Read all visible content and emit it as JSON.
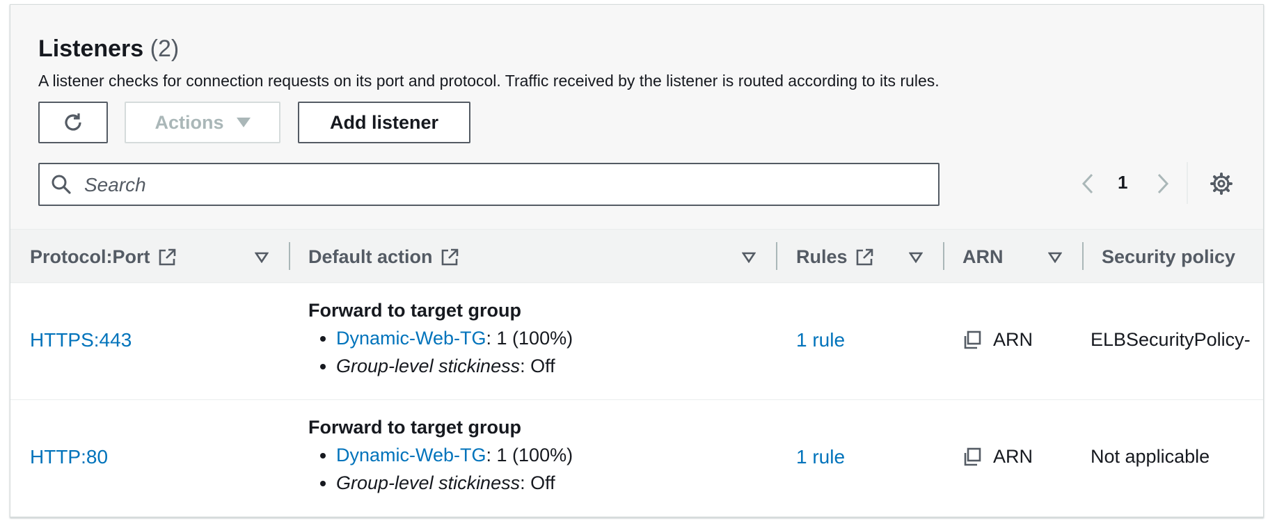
{
  "section": {
    "title": "Listeners",
    "count": "(2)",
    "description": "A listener checks for connection requests on its port and protocol. Traffic received by the listener is routed according to its rules."
  },
  "toolbar": {
    "actions_label": "Actions",
    "add_listener_label": "Add listener"
  },
  "search": {
    "placeholder": "Search"
  },
  "pagination": {
    "current_page": "1"
  },
  "columns": {
    "protocol_port": "Protocol:Port",
    "default_action": "Default action",
    "rules": "Rules",
    "arn": "ARN",
    "security_policy": "Security policy"
  },
  "rows": [
    {
      "protocol_port": "HTTPS:443",
      "action_title": "Forward to target group",
      "target_group": "Dynamic-Web-TG",
      "target_weight": ": 1 (100%)",
      "stickiness_label": "Group-level stickiness",
      "stickiness_value": ": Off",
      "rules": "1 rule",
      "arn": "ARN",
      "security_policy": "ELBSecurityPolicy-"
    },
    {
      "protocol_port": "HTTP:80",
      "action_title": "Forward to target group",
      "target_group": "Dynamic-Web-TG",
      "target_weight": ": 1 (100%)",
      "stickiness_label": "Group-level stickiness",
      "stickiness_value": ": Off",
      "rules": "1 rule",
      "arn": "ARN",
      "security_policy": "Not applicable"
    }
  ],
  "colors": {
    "link": "#0073bb",
    "text": "#16191f",
    "secondary": "#545b64",
    "disabled": "#aab7b8"
  }
}
